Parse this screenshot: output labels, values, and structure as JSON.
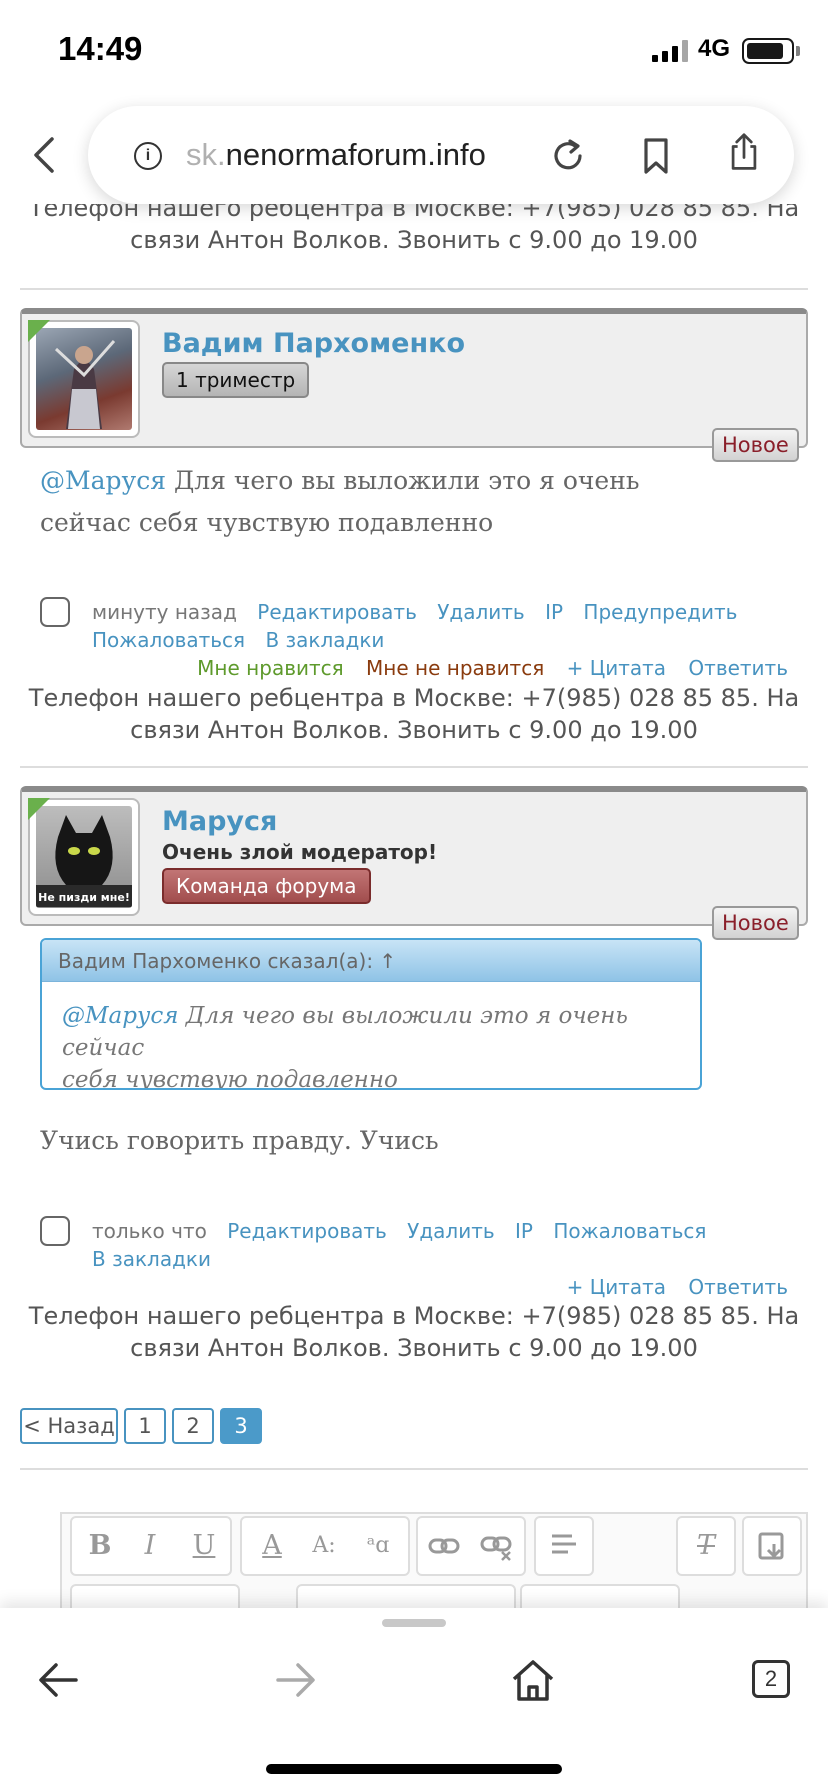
{
  "status_bar": {
    "time": "14:49",
    "network": "4G"
  },
  "browser": {
    "url_faded": "sk.",
    "url_domain": "nenormaforum.info",
    "tab_count": "2"
  },
  "info_line": {
    "line1": "Телефон нашего ребцентра в Москве: +7(985) 028 85 85. На",
    "line2": "связи Антон Волков. Звонить с 9.00 до 19.00"
  },
  "posts": [
    {
      "author": "Вадим Пархоменко",
      "rank": "1 триместр",
      "new_badge": "Новое",
      "mention": "@Маруся",
      "text_line1": " Для чего вы выложили это я очень",
      "text_line2": "сейчас себя чувствую подавленно",
      "time": "минуту назад",
      "actions": [
        "Редактировать",
        "Удалить",
        "IP",
        "Предупредить",
        "Пожаловаться",
        "В закладки"
      ],
      "like": "Мне нравится",
      "dislike": "Мне не нравится",
      "quote": "+ Цитата",
      "reply": "Ответить"
    },
    {
      "author": "Маруся",
      "title": "Очень злой модератор!",
      "rank": "Команда форума",
      "avatar_caption": "Не пизди мне!",
      "new_badge": "Новое",
      "quote_head": "Вадим Пархоменко сказал(а): ↑",
      "quote_mention": "@Маруся",
      "quote_line1": " Для чего вы выложили это я очень сейчас",
      "quote_line2": "себя чувствую подавленно",
      "text": "Учись говорить правду. Учись",
      "time": "только что",
      "actions": [
        "Редактировать",
        "Удалить",
        "IP",
        "Пожаловаться",
        "В закладки"
      ],
      "quote": "+ Цитата",
      "reply": "Ответить"
    }
  ],
  "pagination": {
    "back": "< Назад",
    "pages": [
      "1",
      "2",
      "3"
    ],
    "current": "3"
  },
  "editor": {
    "bold": "B",
    "italic": "I",
    "underline": "U",
    "font_color": "A",
    "font_size": "A:",
    "subscript": "ᵃɑ"
  },
  "colors": {
    "link": "#4893c0",
    "like": "#5e9a2c",
    "dislike": "#8a3b0e",
    "badge_red": "#8a1f2a",
    "quote_border": "#4aa3d6"
  }
}
